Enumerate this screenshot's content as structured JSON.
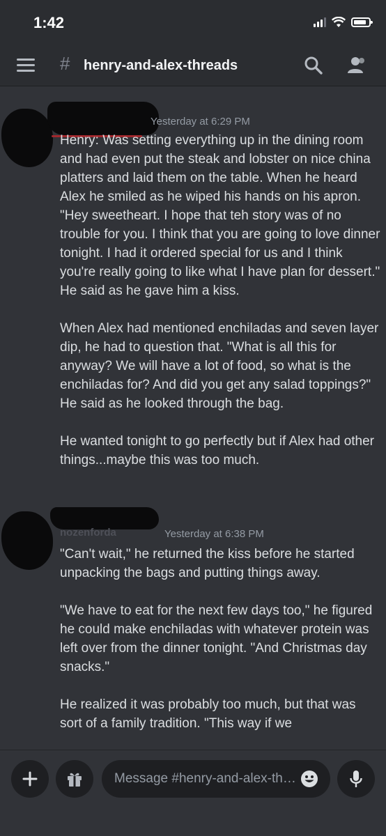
{
  "status_bar": {
    "time": "1:42",
    "icons": [
      "cellular-signal-icon",
      "wifi-icon",
      "battery-icon"
    ]
  },
  "header": {
    "channel_icon": "thread-hash-icon",
    "channel_name": "henry-and-alex-threads",
    "actions": [
      "search-icon",
      "members-icon"
    ]
  },
  "messages": [
    {
      "author_redacted": true,
      "timestamp": "Yesterday at 6:29 PM",
      "paragraphs": [
        "Henry: Was setting everything up in the dining room and had even put the steak and lobster on nice china platters and laid them on the table. When he heard Alex he smiled as he wiped his hands on his apron. \"Hey sweetheart. I hope that teh story was of no trouble for you. I think that you are going to love dinner tonight. I had it ordered special for us and I think you're really going to like what I have plan for dessert.\" He said as he gave him a kiss.",
        "When Alex had mentioned enchiladas and seven layer dip, he had to question that. \"What is all this for anyway? We will have a lot of food, so what is the enchiladas for? And did you get any salad toppings?\" He said as he looked through the bag.",
        "He wanted tonight to go perfectly but if Alex had other things...maybe this was too much."
      ]
    },
    {
      "author_redacted": true,
      "author_visible_fragment": "nozenforda",
      "timestamp": "Yesterday at 6:38 PM",
      "paragraphs": [
        "\"Can't wait,\" he returned the kiss before he started unpacking the bags and putting things away.",
        "\"We have to eat for the next few days too,\" he figured he could make enchiladas with whatever protein was left over from the dinner tonight. \"And Christmas day snacks.\"",
        "He realized it was probably too much, but that was sort of a family tradition. \"This way if we"
      ]
    }
  ],
  "composer": {
    "placeholder": "Message #henry-and-alex-threads",
    "buttons": [
      "plus-icon",
      "gift-icon",
      "emoji-icon",
      "microphone-icon"
    ]
  },
  "colors": {
    "background": "#313338",
    "header": "#2b2d31",
    "input": "#1e1f22",
    "text": "#dbdee1",
    "muted": "#949ba4"
  }
}
